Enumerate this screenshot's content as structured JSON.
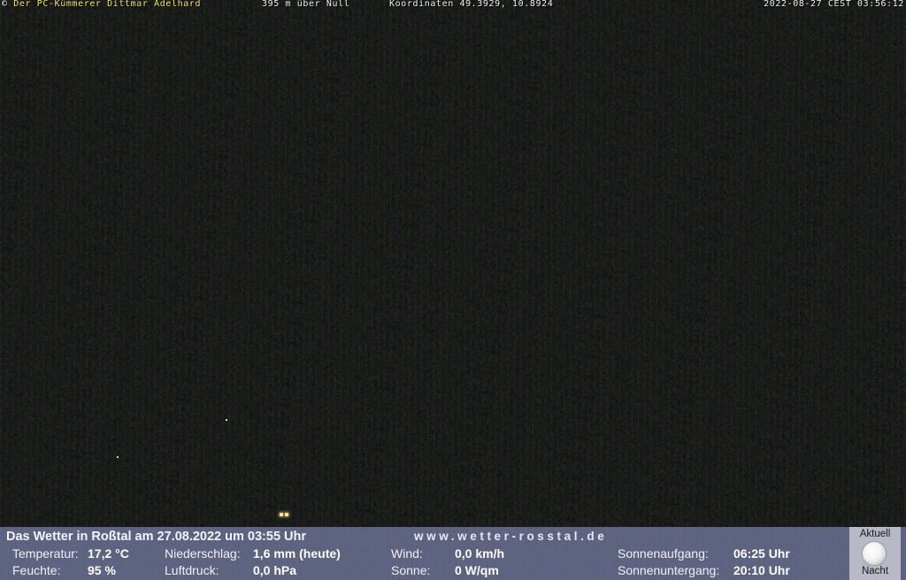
{
  "overlay": {
    "copyright_symbol": "©",
    "copyright_text": "Der PC-Kümmerer Dittmar Adelhard",
    "altitude": "395 m über Null",
    "coordinates": "Koordinaten 49.3929, 10.8924",
    "timestamp": "2022-08-27 CEST 03:56:12"
  },
  "weather": {
    "title": "Das Wetter in Roßtal am 27.08.2022 um 03:55 Uhr",
    "url": "www.wetter-rosstal.de",
    "temperature_label": "Temperatur:",
    "temperature_value": "17,2 °C",
    "humidity_label": "Feuchte:",
    "humidity_value": "95 %",
    "precipitation_label": "Niederschlag:",
    "precipitation_value": "1,6 mm (heute)",
    "pressure_label": "Luftdruck:",
    "pressure_value": "0,0 hPa",
    "wind_label": "Wind:",
    "wind_value": "0,0 km/h",
    "sun_label": "Sonne:",
    "sun_value": "0 W/qm",
    "sunrise_label": "Sonnenaufgang:",
    "sunrise_value": "06:25 Uhr",
    "sunset_label": "Sonnenuntergang:",
    "sunset_value": "20:10 Uhr"
  },
  "moon": {
    "label_top": "Aktuell",
    "label_bottom": "Nacht",
    "icon": "moon-icon"
  }
}
